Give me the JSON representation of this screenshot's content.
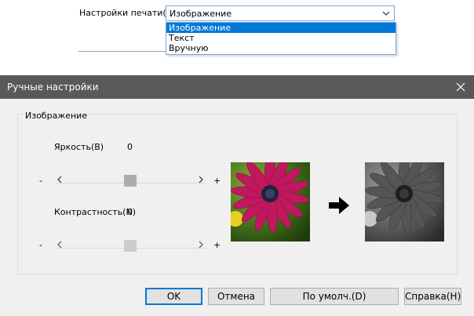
{
  "print_settings": {
    "label": "Настройки печати(I)",
    "selected": "Изображение",
    "options": [
      "Изображение",
      "Текст",
      "Вручную"
    ]
  },
  "dialog": {
    "title": "Ручные настройки",
    "group_label": "Изображение",
    "brightness": {
      "label": "Яркость(B)",
      "value": "0",
      "minus": "-",
      "plus": "+",
      "level": 0.5
    },
    "contrast": {
      "label": "Контрастность(N)",
      "value": "0",
      "minus": "-",
      "plus": "+",
      "level": 0.5
    },
    "buttons": {
      "ok": "OK",
      "cancel": "Отмена",
      "default": "По умолч.(D)",
      "help": "Справка(H)"
    }
  },
  "colors": {
    "accent": "#0078d7",
    "titlebar": "#595959",
    "dialog_bg": "#f0f0f0",
    "flower_petal": "#c0185e"
  }
}
